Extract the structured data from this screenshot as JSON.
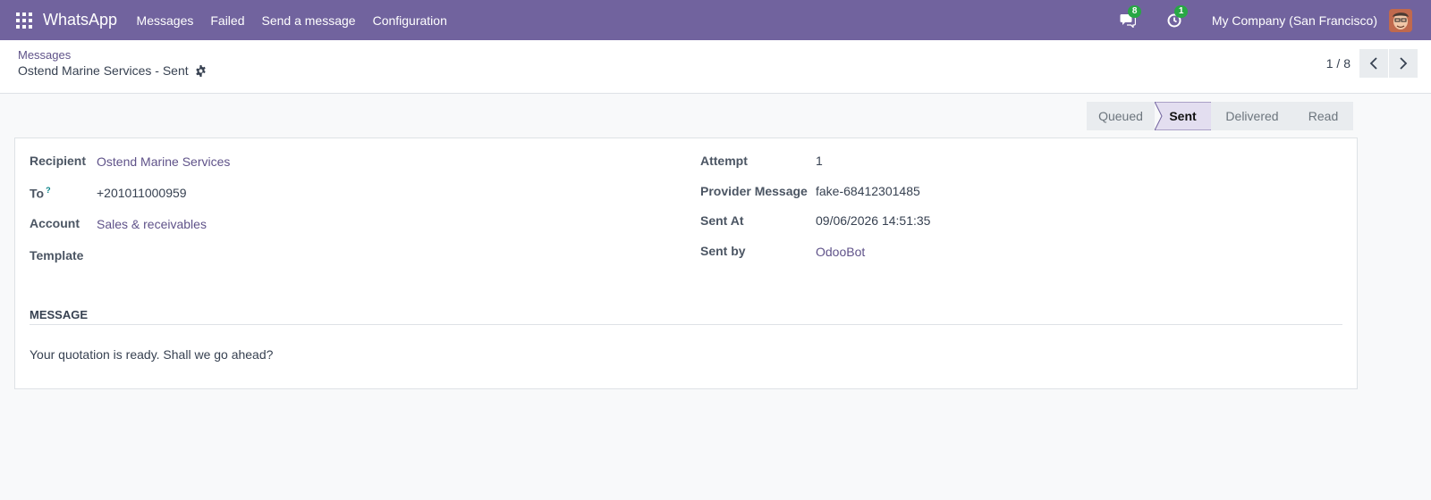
{
  "navbar": {
    "app_name": "WhatsApp",
    "menu": [
      "Messages",
      "Failed",
      "Send a message",
      "Configuration"
    ],
    "messages_badge": "8",
    "activity_badge": "1",
    "company": "My Company (San Francisco)",
    "bg_color": "#71639e"
  },
  "breadcrumb": {
    "parent": "Messages",
    "current": "Ostend Marine Services - Sent"
  },
  "pager": {
    "value": "1 / 8"
  },
  "statusbar": {
    "stages": [
      "Queued",
      "Sent",
      "Delivered",
      "Read"
    ],
    "active": "Sent"
  },
  "form": {
    "left": [
      {
        "label": "Recipient",
        "value": "Ostend Marine Services"
      },
      {
        "label": "To",
        "help": "?",
        "value": "+201011000959"
      },
      {
        "label": "Account",
        "value": "Sales & receivables"
      },
      {
        "label": "Template",
        "value": ""
      }
    ],
    "right": [
      {
        "label": "Attempt",
        "value": "1"
      },
      {
        "label": "Provider Message",
        "value": "fake-68412301485"
      },
      {
        "label": "Sent At",
        "value": "09/06/2026 14:51:35"
      },
      {
        "label": "Sent by",
        "value": "OdooBot"
      }
    ],
    "section_title": "MESSAGE",
    "message": "Your quotation is ready. Shall we go ahead?"
  }
}
